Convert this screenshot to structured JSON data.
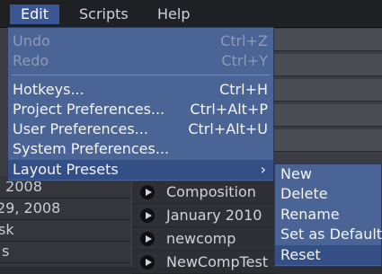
{
  "menubar": {
    "items": [
      "Edit",
      "Scripts",
      "Help"
    ]
  },
  "edit_menu": {
    "items": [
      {
        "label": "Undo",
        "shortcut": "Ctrl+Z",
        "disabled": true
      },
      {
        "label": "Redo",
        "shortcut": "Ctrl+Y",
        "disabled": true
      },
      {
        "label": "Hotkeys...",
        "shortcut": "Ctrl+H"
      },
      {
        "label": "Project Preferences...",
        "shortcut": "Ctrl+Alt+P"
      },
      {
        "label": "User Preferences...",
        "shortcut": "Ctrl+Alt+U"
      },
      {
        "label": "System Preferences..."
      },
      {
        "label": "Layout Presets",
        "submenu_arrow": "›"
      }
    ]
  },
  "layout_presets_submenu": {
    "items": [
      "New",
      "Delete",
      "Rename",
      "Set as Default",
      "Reset"
    ]
  },
  "background": {
    "left_rows": [
      ", 2008",
      " 29, 2008",
      "sk",
      "s"
    ],
    "compositions": [
      "Composition",
      "January 2010",
      "newcomp",
      "NewCompTest"
    ]
  }
}
